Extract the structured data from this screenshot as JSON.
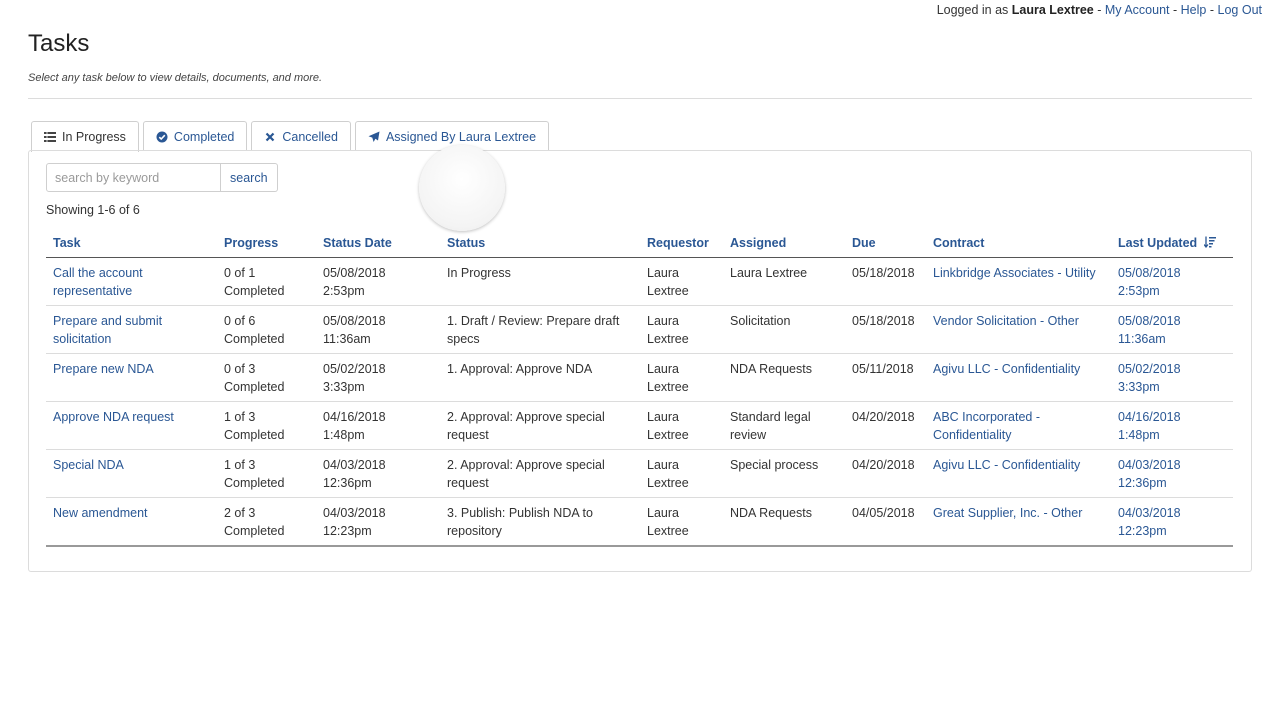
{
  "header": {
    "logged_in_prefix": "Logged in as",
    "user_name": "Laura Lextree",
    "sep": "-",
    "my_account": "My Account",
    "help": "Help",
    "log_out": "Log Out"
  },
  "page": {
    "title": "Tasks",
    "subtitle": "Select any task below to view details, documents, and more."
  },
  "tabs": [
    {
      "label": "In Progress",
      "icon": "list-icon",
      "active": true
    },
    {
      "label": "Completed",
      "icon": "check-circle-icon",
      "active": false
    },
    {
      "label": "Cancelled",
      "icon": "x-icon",
      "active": false
    },
    {
      "label": "Assigned By Laura Lextree",
      "icon": "paper-plane-icon",
      "active": false
    }
  ],
  "search": {
    "placeholder": "search by keyword",
    "value": "",
    "button_label": "search"
  },
  "showing": "Showing 1-6 of 6",
  "table": {
    "columns": [
      "Task",
      "Progress",
      "Status Date",
      "Status",
      "Requestor",
      "Assigned",
      "Due",
      "Contract",
      "Last Updated"
    ],
    "sorted_column": "Last Updated",
    "rows": [
      {
        "task": "Call the account representative",
        "progress_count": "0 of 1",
        "progress_label": "Completed",
        "status_date": "05/08/2018",
        "status_time": "2:53pm",
        "status": "In Progress",
        "requestor_first": "Laura",
        "requestor_last": "Lextree",
        "assigned": "Laura Lextree",
        "due": "05/18/2018",
        "contract": "Linkbridge Associates - Utility",
        "updated_date": "05/08/2018",
        "updated_time": "2:53pm"
      },
      {
        "task": "Prepare and submit solicitation",
        "progress_count": "0 of 6",
        "progress_label": "Completed",
        "status_date": "05/08/2018",
        "status_time": "11:36am",
        "status": "1. Draft / Review: Prepare draft specs",
        "requestor_first": "Laura",
        "requestor_last": "Lextree",
        "assigned": "Solicitation",
        "due": "05/18/2018",
        "contract": "Vendor Solicitation - Other",
        "updated_date": "05/08/2018",
        "updated_time": "11:36am"
      },
      {
        "task": "Prepare new NDA",
        "progress_count": "0 of 3",
        "progress_label": "Completed",
        "status_date": "05/02/2018",
        "status_time": "3:33pm",
        "status": "1. Approval: Approve NDA",
        "requestor_first": "Laura",
        "requestor_last": "Lextree",
        "assigned": "NDA Requests",
        "due": "05/11/2018",
        "contract": "Agivu LLC - Confidentiality",
        "updated_date": "05/02/2018",
        "updated_time": "3:33pm"
      },
      {
        "task": "Approve NDA request",
        "progress_count": "1 of 3",
        "progress_label": "Completed",
        "status_date": "04/16/2018",
        "status_time": "1:48pm",
        "status": "2. Approval: Approve special request",
        "requestor_first": "Laura",
        "requestor_last": "Lextree",
        "assigned": "Standard legal review",
        "due": "04/20/2018",
        "contract": "ABC Incorporated - Confidentiality",
        "updated_date": "04/16/2018",
        "updated_time": "1:48pm"
      },
      {
        "task": "Special NDA",
        "progress_count": "1 of 3",
        "progress_label": "Completed",
        "status_date": "04/03/2018",
        "status_time": "12:36pm",
        "status": "2. Approval: Approve special request",
        "requestor_first": "Laura",
        "requestor_last": "Lextree",
        "assigned": "Special process",
        "due": "04/20/2018",
        "contract": "Agivu LLC - Confidentiality",
        "updated_date": "04/03/2018",
        "updated_time": "12:36pm"
      },
      {
        "task": "New amendment",
        "progress_count": "2 of 3",
        "progress_label": "Completed",
        "status_date": "04/03/2018",
        "status_time": "12:23pm",
        "status": "3. Publish: Publish NDA to repository",
        "requestor_first": "Laura",
        "requestor_last": "Lextree",
        "assigned": "NDA Requests",
        "due": "04/05/2018",
        "contract": "Great Supplier, Inc. - Other",
        "updated_date": "04/03/2018",
        "updated_time": "12:23pm"
      }
    ]
  },
  "colors": {
    "link": "#2a5794",
    "text": "#333333",
    "border": "#dcdcdc"
  }
}
